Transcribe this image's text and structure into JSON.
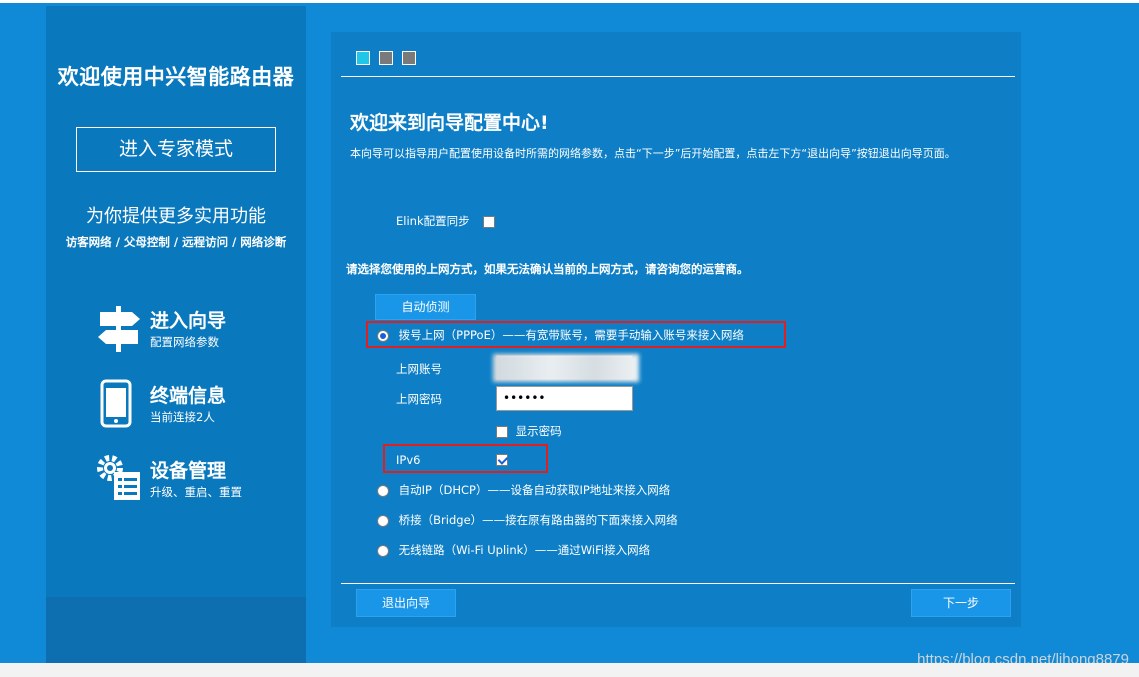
{
  "sidebar": {
    "title": "欢迎使用中兴智能路由器",
    "expert_button": "进入专家模式",
    "subtitle": "为你提供更多实用功能",
    "features": "访客网络 / 父母控制 / 远程访问 / 网络诊断",
    "items": [
      {
        "label": "进入向导",
        "desc": "配置网络参数",
        "icon": "signpost-icon"
      },
      {
        "label": "终端信息",
        "desc": "当前连接2人",
        "icon": "phone-icon"
      },
      {
        "label": "设备管理",
        "desc": "升级、重启、重置",
        "icon": "gear-list-icon"
      }
    ]
  },
  "wizard": {
    "steps": [
      {
        "state": "active",
        "color": "#1fc6e8"
      },
      {
        "state": "inactive",
        "color": "#7a7a7a"
      },
      {
        "state": "inactive",
        "color": "#7a7a7a"
      }
    ],
    "title": "欢迎来到向导配置中心!",
    "description": "本向导可以指导用户配置使用设备时所需的网络参数，点击“下一步”后开始配置，点击左下方“退出向导”按钮退出向导页面。",
    "elink_label": "Elink配置同步",
    "elink_checked": false,
    "select_prompt": "请选择您使用的上网方式，如果无法确认当前的上网方式，请咨询您的运营商。",
    "auto_detect_button": "自动侦测",
    "options": [
      {
        "label": "拨号上网（PPPoE）——有宽带账号，需要手动输入账号来接入网络",
        "selected": true
      },
      {
        "label": "自动IP（DHCP）——设备自动获取IP地址来接入网络",
        "selected": false
      },
      {
        "label": "桥接（Bridge）——接在原有路由器的下面来接入网络",
        "selected": false
      },
      {
        "label": "无线链路（Wi-Fi Uplink）——通过WiFi接入网络",
        "selected": false
      }
    ],
    "account_label": "上网账号",
    "account_value": "",
    "password_label": "上网密码",
    "password_value": "••••••",
    "show_password_label": "显示密码",
    "show_password_checked": false,
    "ipv6_label": "IPv6",
    "ipv6_checked": true,
    "exit_button": "退出向导",
    "next_button": "下一步"
  },
  "watermark": "https://blog.csdn.net/lihong8879",
  "colors": {
    "background": "#1089d6",
    "panel": "#0e7fc6",
    "sidebar": "#0a78bd",
    "highlight_box": "#e02020",
    "button": "#1a96e8"
  }
}
